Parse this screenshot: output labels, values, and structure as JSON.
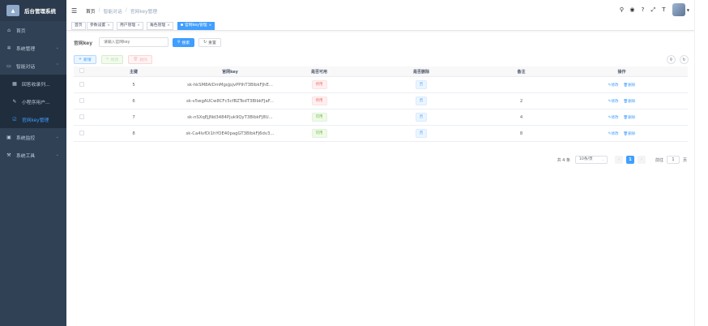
{
  "app": {
    "title": "后台管理系统"
  },
  "sidebar": {
    "items": [
      {
        "label": "首页",
        "icon": "home-icon"
      },
      {
        "label": "系统管理",
        "icon": "gear-icon"
      },
      {
        "label": "智能对话",
        "icon": "chat-icon"
      },
      {
        "label": "回答收录列...",
        "icon": "grid-icon"
      },
      {
        "label": "小程序用户...",
        "icon": "edit-icon"
      },
      {
        "label": "官网key管理",
        "icon": "checkbox-icon"
      },
      {
        "label": "系统监控",
        "icon": "monitor-icon"
      },
      {
        "label": "系统工具",
        "icon": "tool-icon"
      }
    ]
  },
  "navbar": {
    "breadcrumb": [
      "首页",
      "智能对话",
      "官网key管理"
    ],
    "font_size_label": "T",
    "avatar_alt": "avatar"
  },
  "tags": [
    {
      "label": "首页"
    },
    {
      "label": "参数设置"
    },
    {
      "label": "用户管理"
    },
    {
      "label": "角色管理"
    },
    {
      "label": "官网key管理"
    }
  ],
  "search": {
    "label": "官网key",
    "placeholder": "请输入官网key",
    "search_button": "搜索",
    "reset_button": "重置"
  },
  "toolbar": {
    "add": "新增",
    "edit": "修改",
    "delete": "删除"
  },
  "table": {
    "columns": [
      "主键",
      "官网key",
      "是否可用",
      "是否删除",
      "备注",
      "操作"
    ],
    "rows": [
      {
        "id": "5",
        "key": "sk-hkSM8AlDmMgsJpjvPPIhT3BlbkFJhE...",
        "enabled": "停用",
        "enabled_type": "danger",
        "deleted": "否",
        "remark": ""
      },
      {
        "id": "6",
        "key": "sk-v5wgAUCw8CFc5cfBZTedT3BlbkFJaF...",
        "enabled": "停用",
        "enabled_type": "danger",
        "deleted": "否",
        "remark": "2"
      },
      {
        "id": "7",
        "key": "sk-nSXqEjJNd3484Pjuk9QyT3BlbkFJ8U...",
        "enabled": "可用",
        "enabled_type": "success",
        "deleted": "否",
        "remark": "4"
      },
      {
        "id": "8",
        "key": "sk-Ca4lvfDi1hYOE40pagGT3BlbkFJ6dv3...",
        "enabled": "可用",
        "enabled_type": "success",
        "deleted": "否",
        "remark": "8"
      }
    ],
    "op_edit": "修改",
    "op_delete": "删除"
  },
  "pagination": {
    "total": "共 4 条",
    "page_size": "10条/页",
    "current": "1",
    "goto_label": "前往",
    "goto_value": "1",
    "page_suffix": "页"
  }
}
